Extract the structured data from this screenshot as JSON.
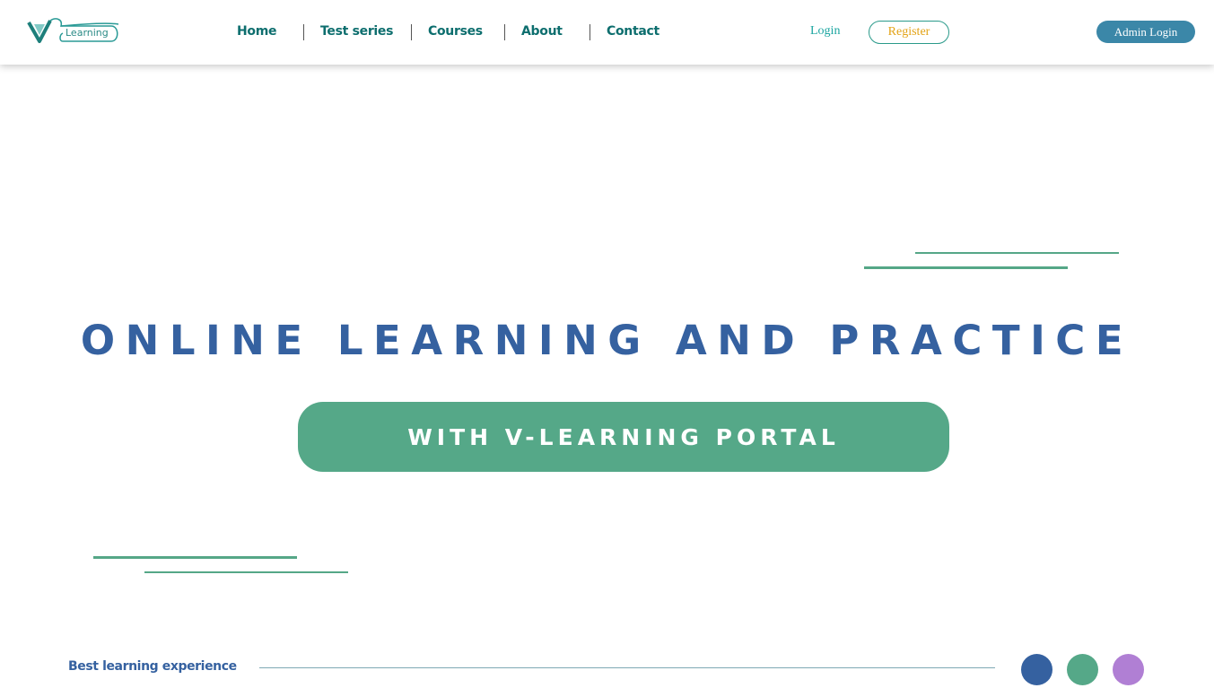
{
  "header": {
    "logo": {
      "text": "Learning"
    },
    "nav": [
      "Home",
      "Test series",
      "Courses",
      "About",
      "Contact"
    ],
    "login_label": "Login",
    "register_label": "Register",
    "admin_login_label": "Admin Login"
  },
  "hero": {
    "title": "ONLINE LEARNING AND PRACTICE",
    "subtitle": "WITH V-LEARNING PORTAL"
  },
  "footer": {
    "tagline": "Best learning experience"
  },
  "colors": {
    "brand_teal": "#0d6e6e",
    "title_blue": "#3561a0",
    "accent_green": "#55a888",
    "register_text": "#e3a316",
    "admin_button": "#3b87a8",
    "dot_blue": "#3561a0",
    "dot_green": "#55a888",
    "dot_purple": "#b07fd4"
  }
}
